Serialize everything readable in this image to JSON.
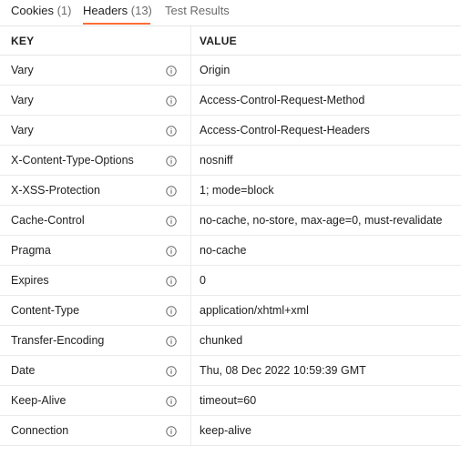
{
  "tabs": [
    {
      "label": "Cookies",
      "count": "(1)"
    },
    {
      "label": "Headers",
      "count": "(13)"
    },
    {
      "label": "Test Results"
    }
  ],
  "active_tab": "Headers",
  "accent_color": "#ff6c37",
  "table": {
    "key_header": "KEY",
    "value_header": "VALUE",
    "info_icon": "info-circle-icon",
    "rows": [
      {
        "key": "Vary",
        "value": "Origin"
      },
      {
        "key": "Vary",
        "value": "Access-Control-Request-Method"
      },
      {
        "key": "Vary",
        "value": "Access-Control-Request-Headers"
      },
      {
        "key": "X-Content-Type-Options",
        "value": "nosniff"
      },
      {
        "key": "X-XSS-Protection",
        "value": "1; mode=block"
      },
      {
        "key": "Cache-Control",
        "value": "no-cache, no-store, max-age=0, must-revalidate"
      },
      {
        "key": "Pragma",
        "value": "no-cache"
      },
      {
        "key": "Expires",
        "value": "0"
      },
      {
        "key": "Content-Type",
        "value": "application/xhtml+xml"
      },
      {
        "key": "Transfer-Encoding",
        "value": "chunked"
      },
      {
        "key": "Date",
        "value": "Thu, 08 Dec 2022 10:59:39 GMT"
      },
      {
        "key": "Keep-Alive",
        "value": "timeout=60"
      },
      {
        "key": "Connection",
        "value": "keep-alive"
      }
    ]
  }
}
